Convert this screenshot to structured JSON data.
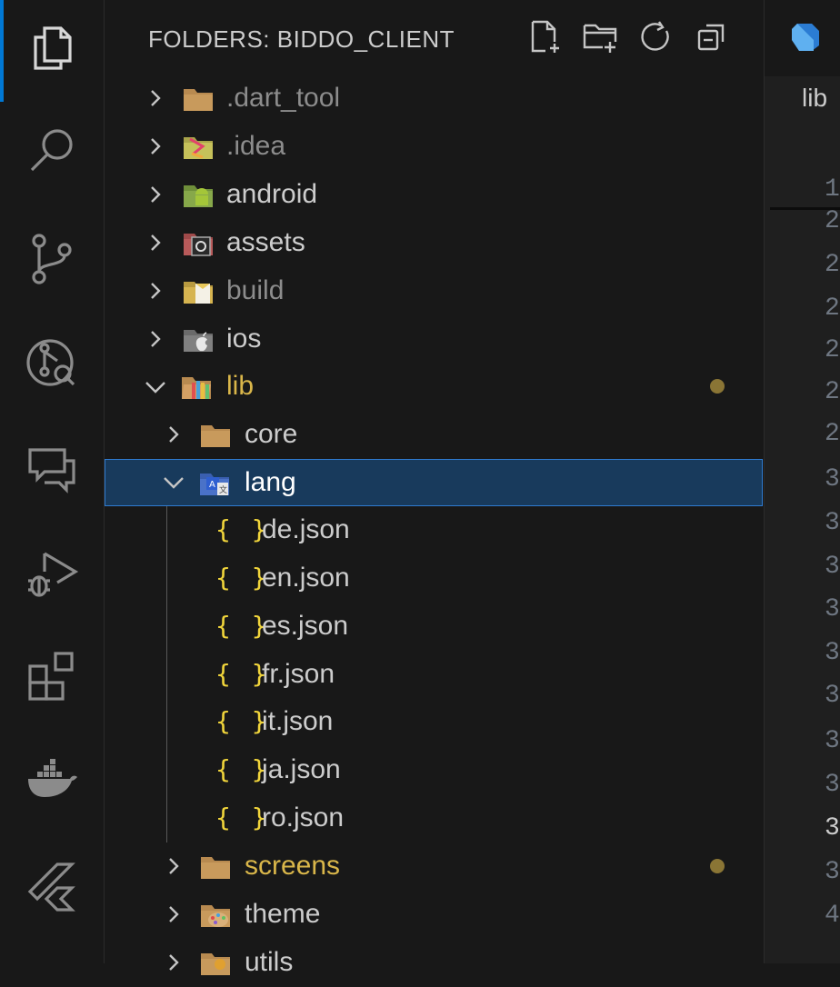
{
  "explorer": {
    "title": "FOLDERS: BIDDO_CLIENT",
    "actions": [
      "new-file-icon",
      "new-folder-icon",
      "refresh-icon",
      "collapse-all-icon"
    ]
  },
  "tree": [
    {
      "label": ".dart_tool",
      "expanded": false,
      "icon": "folder-icon",
      "color": "#8c8c8c"
    },
    {
      "label": ".idea",
      "expanded": false,
      "icon": "idea-folder-icon",
      "color": "#8c8c8c"
    },
    {
      "label": "android",
      "expanded": false,
      "icon": "android-folder-icon",
      "color": "#cccccc"
    },
    {
      "label": "assets",
      "expanded": false,
      "icon": "assets-folder-icon",
      "color": "#cccccc"
    },
    {
      "label": "build",
      "expanded": false,
      "icon": "build-folder-icon",
      "color": "#8c8c8c"
    },
    {
      "label": "ios",
      "expanded": false,
      "icon": "ios-folder-icon",
      "color": "#cccccc"
    },
    {
      "label": "lib",
      "expanded": true,
      "icon": "lib-folder-icon",
      "color": "#d9b64a",
      "modified": true
    },
    {
      "label": "core",
      "expanded": false,
      "icon": "folder-icon",
      "color": "#cccccc"
    },
    {
      "label": "lang",
      "expanded": true,
      "icon": "lang-folder-icon",
      "color": "#cccccc",
      "selected": true
    },
    {
      "label": "de.json",
      "icon": "json-icon",
      "color": "#cccccc"
    },
    {
      "label": "en.json",
      "icon": "json-icon",
      "color": "#cccccc"
    },
    {
      "label": "es.json",
      "icon": "json-icon",
      "color": "#cccccc"
    },
    {
      "label": "fr.json",
      "icon": "json-icon",
      "color": "#cccccc"
    },
    {
      "label": "it.json",
      "icon": "json-icon",
      "color": "#cccccc"
    },
    {
      "label": "ja.json",
      "icon": "json-icon",
      "color": "#cccccc"
    },
    {
      "label": "ro.json",
      "icon": "json-icon",
      "color": "#cccccc"
    },
    {
      "label": "screens",
      "expanded": false,
      "icon": "folder-icon",
      "color": "#d9b64a",
      "modified": true
    },
    {
      "label": "theme",
      "expanded": false,
      "icon": "theme-folder-icon",
      "color": "#cccccc"
    },
    {
      "label": "utils",
      "expanded": false,
      "icon": "utils-folder-icon",
      "color": "#cccccc"
    }
  ],
  "json_glyph": "{ }",
  "editor": {
    "breadcrumb": "lib",
    "line_numbers": [
      "1",
      "2",
      "2",
      "2",
      "2",
      "2",
      "2",
      "3",
      "3",
      "3",
      "3",
      "3",
      "3",
      "3",
      "3",
      "3",
      "3",
      "4"
    ]
  },
  "colors": {
    "accent": "#0078d4",
    "selection_bg": "#183a5c",
    "selection_border": "#2f7bd0",
    "modified_dot": "#8a7535",
    "json_icon": "#f1d53b"
  }
}
